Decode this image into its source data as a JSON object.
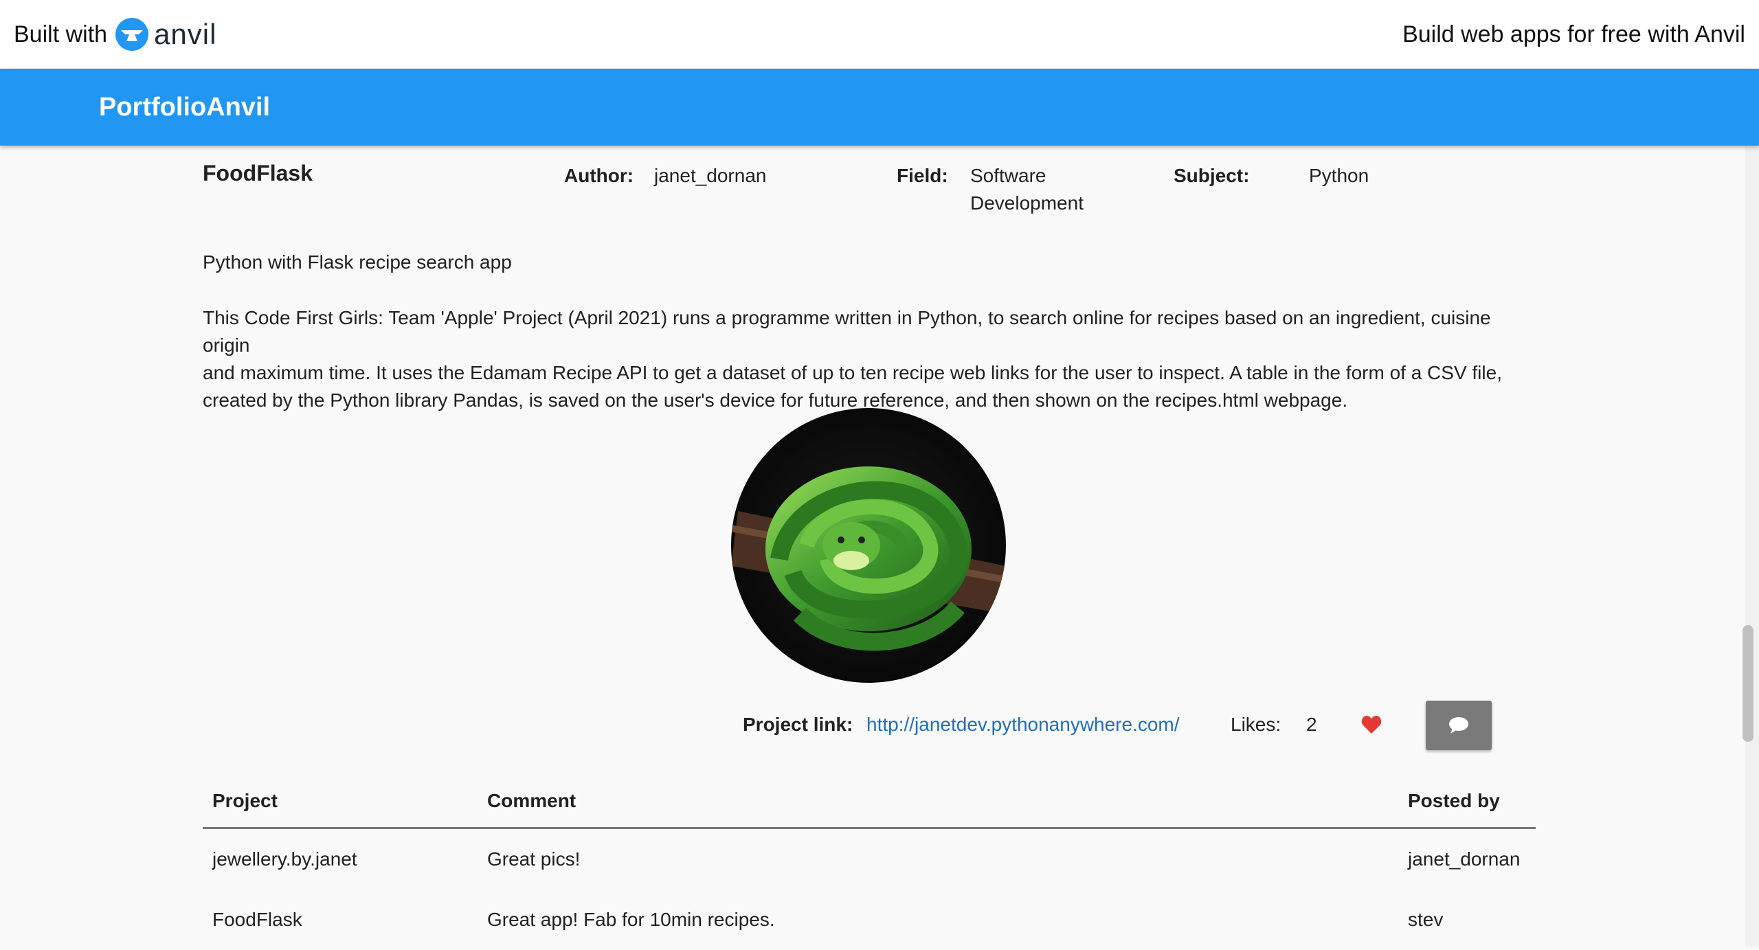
{
  "topbar": {
    "built_with": "Built with",
    "logo_text": "anvil",
    "promo": "Build web apps for free with Anvil"
  },
  "app": {
    "title": "PortfolioAnvil"
  },
  "project": {
    "name": "FoodFlask",
    "author_label": "Author:",
    "author": "janet_dornan",
    "field_label": "Field:",
    "field_line1": "Software",
    "field_line2": "Development",
    "subject_label": "Subject:",
    "subject": "Python",
    "summary": "Python with Flask recipe search app",
    "description_line1": "This Code First Girls: Team 'Apple' Project (April 2021) runs a programme written in Python, to search online for recipes based on an ingredient, cuisine origin",
    "description_line2": "and maximum time. It uses the Edamam Recipe API to get a dataset of up to ten recipe web links for the user to inspect. A table in the form of a CSV file,",
    "description_line3": "created by the Python library Pandas, is saved on the user's device for future reference, and then shown on the recipes.html webpage.",
    "link_label": "Project link:",
    "link_url": "http://janetdev.pythonanywhere.com/",
    "likes_label": "Likes:",
    "likes": "2",
    "image_icon": "green-snake-image",
    "heart_icon": "heart-icon",
    "comment_icon": "speech-bubble-icon"
  },
  "comments_table": {
    "headers": [
      "Project",
      "Comment",
      "Posted by"
    ],
    "rows": [
      [
        "jewellery.by.janet",
        "Great pics!",
        "janet_dornan"
      ],
      [
        "FoodFlask",
        "Great app! Fab for 10min recipes.",
        "stev"
      ]
    ]
  },
  "colors": {
    "appbar": "#2196f3",
    "link": "#1e6fbf",
    "heart": "#e53935",
    "comment_button": "#7a7a7a"
  }
}
